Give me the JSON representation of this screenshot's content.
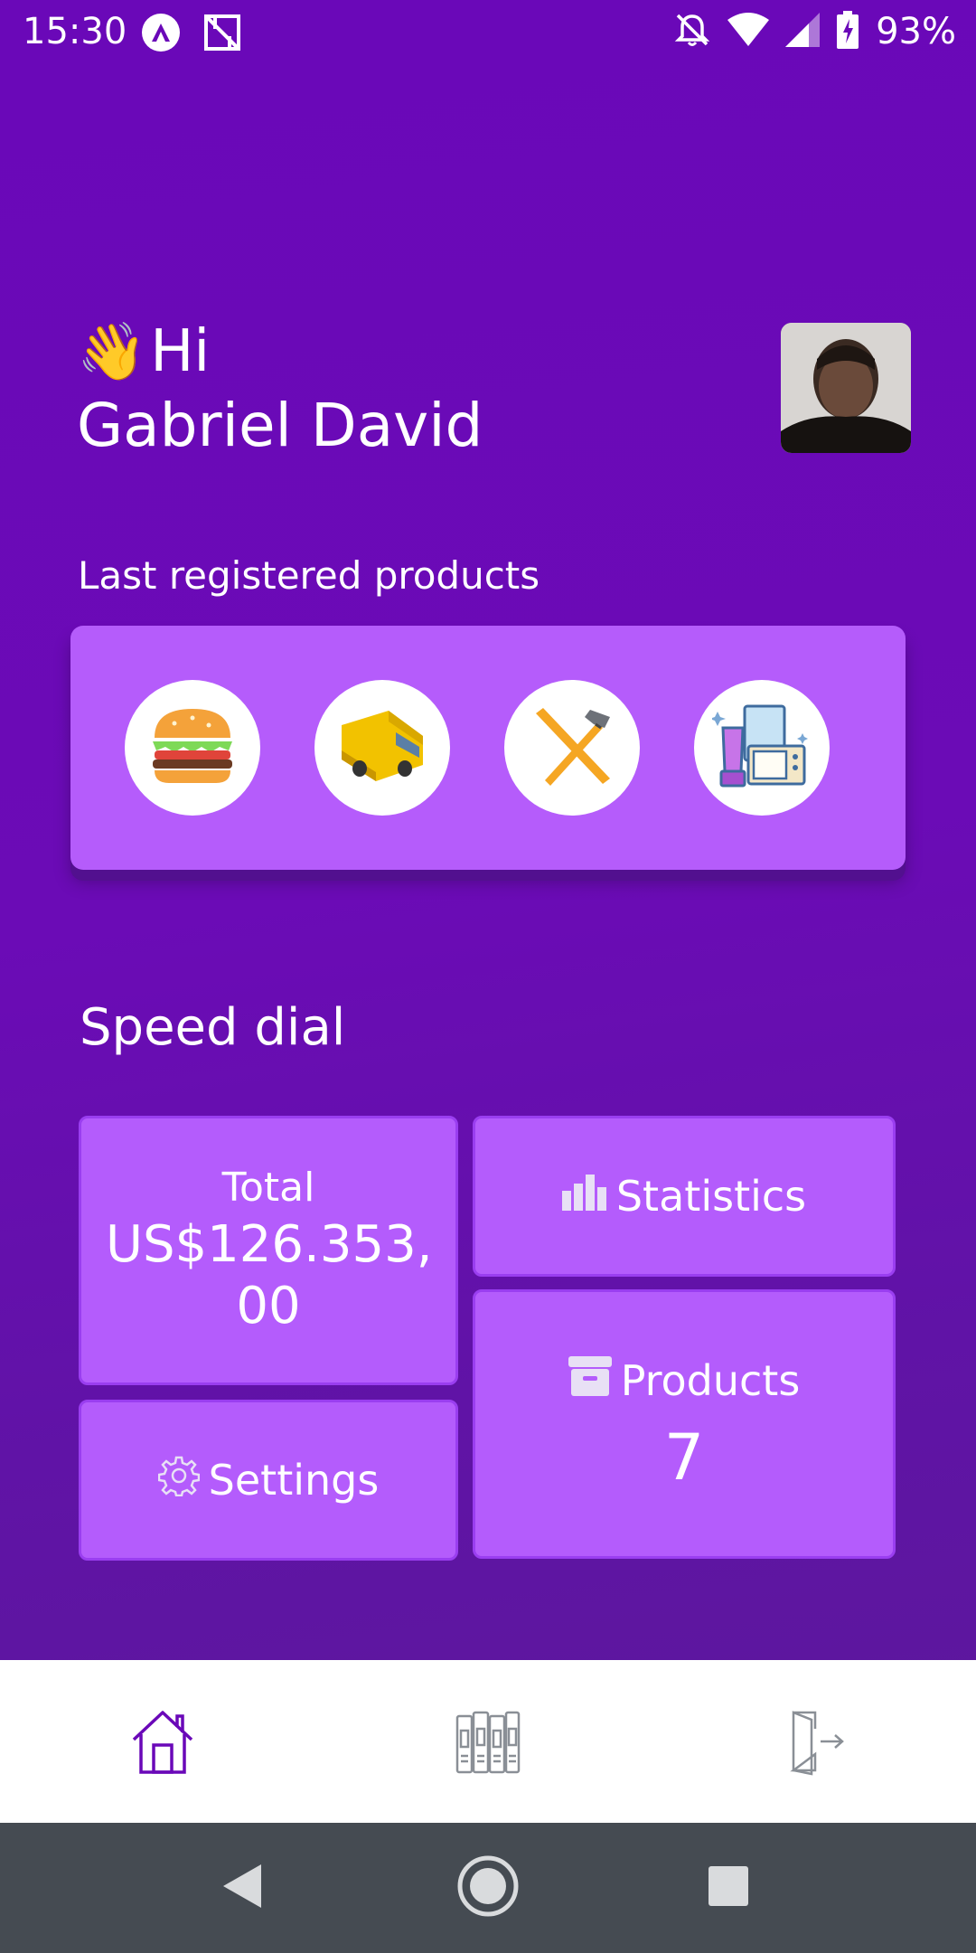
{
  "status_bar": {
    "time": "15:30",
    "battery": "93%",
    "icons": [
      "a-circle-icon",
      "crop-icon",
      "bell-off-icon",
      "wifi-icon",
      "signal-icon",
      "battery-charging-icon"
    ]
  },
  "greeting": {
    "wave_emoji": "👋",
    "hi": "Hi",
    "name": "Gabriel David"
  },
  "products_section": {
    "label": "Last registered products",
    "items": [
      {
        "icon": "burger-icon"
      },
      {
        "icon": "van-icon"
      },
      {
        "icon": "tools-icon"
      },
      {
        "icon": "appliances-icon"
      }
    ]
  },
  "speed_dial": {
    "title": "Speed dial",
    "total_label": "Total",
    "total_value": "US$126.353,\n00",
    "statistics_label": "Statistics",
    "products_label": "Products",
    "products_count": "7",
    "settings_label": "Settings"
  },
  "bottom_nav": {
    "items": [
      "home-icon",
      "library-icon",
      "logout-icon"
    ],
    "active_color": "#6a08b8"
  },
  "colors": {
    "background": "#6a08b8",
    "card": "#b55cfb",
    "tile": "#b45cfc"
  }
}
